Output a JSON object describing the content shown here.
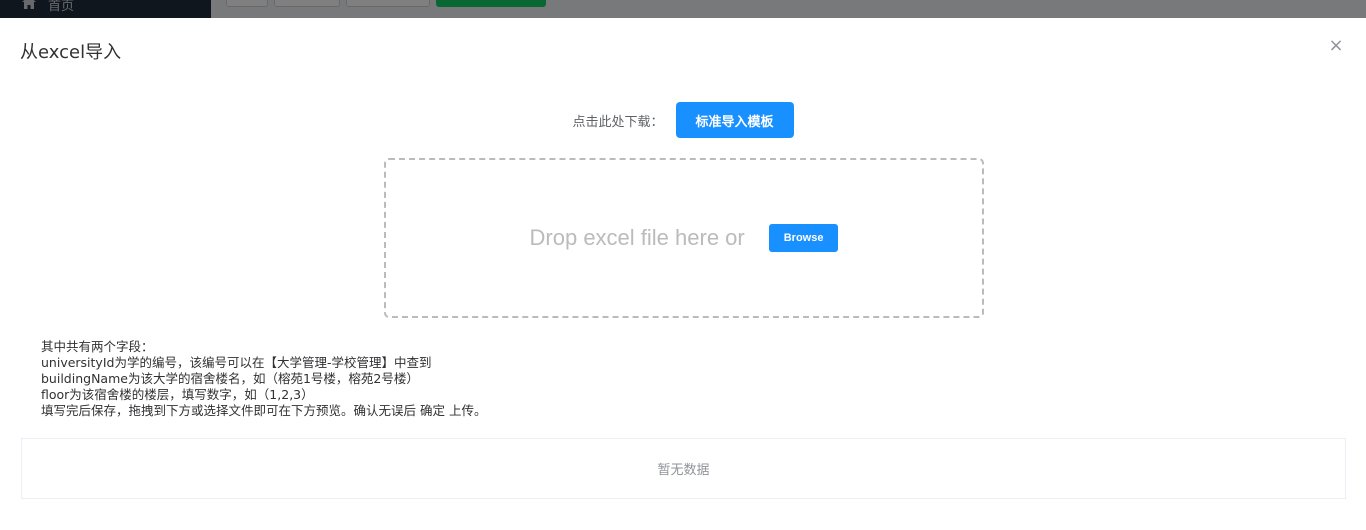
{
  "background": {
    "sidebar": {
      "home_label": "首页"
    }
  },
  "dialog": {
    "title": "从excel导入",
    "close_symbol": "×",
    "download": {
      "label": "点击此处下载：",
      "template_button": "标准导入模板"
    },
    "dropzone": {
      "text": "Drop excel file here or",
      "browse_button": "Browse"
    },
    "instructions": [
      "其中共有两个字段：",
      "universityId为学的编号，该编号可以在【大学管理-学校管理】中查到",
      "buildingName为该大学的宿舍楼名，如（榕苑1号楼，榕苑2号楼）",
      "floor为该宿舍楼的楼层，填写数字，如（1,2,3）",
      "填写完后保存，拖拽到下方或选择文件即可在下方预览。确认无误后 确定 上传。"
    ],
    "table": {
      "empty_text": "暂无数据"
    }
  },
  "colors": {
    "primary": "#1890ff",
    "sidebar": "#1f2d3d",
    "success": "#13ce66"
  }
}
